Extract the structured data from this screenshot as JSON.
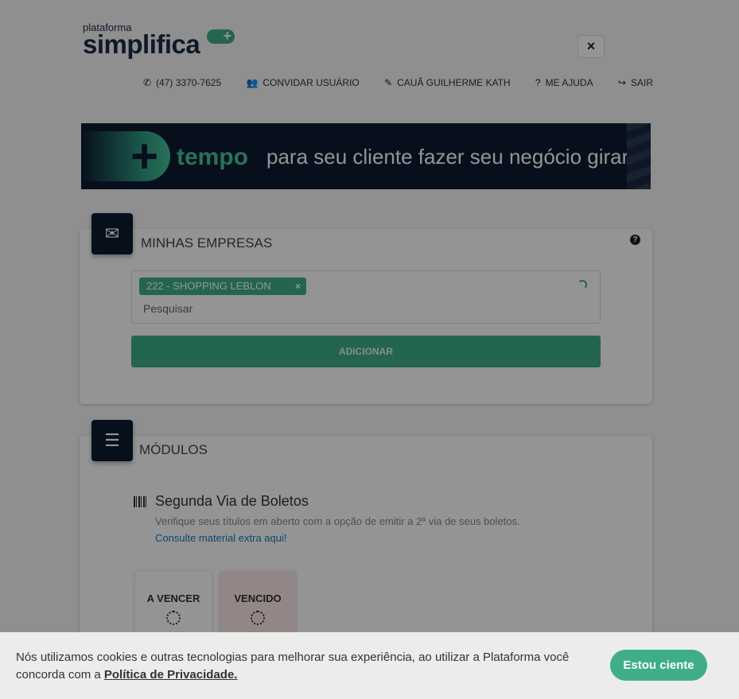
{
  "header": {
    "logo_small": "plataforma",
    "logo_big": "simplifica",
    "logo_plus": "+",
    "close_label": "×",
    "nav": [
      {
        "icon": "phone-icon",
        "glyph": "✆",
        "label": "(47) 3370-7625"
      },
      {
        "icon": "users-icon",
        "glyph": "👥",
        "label": "CONVIDAR USUÁRIO"
      },
      {
        "icon": "pencil-icon",
        "glyph": "✎",
        "label": "CAUÃ GUILHERME KATH"
      },
      {
        "icon": "question-icon",
        "glyph": "?",
        "label": "ME AJUDA"
      },
      {
        "icon": "signout-icon",
        "glyph": "↪",
        "label": "SAIR"
      }
    ]
  },
  "banner": {
    "plus": "+",
    "bold_word": "tempo",
    "rest": "para seu cliente fazer seu negócio girar"
  },
  "empresas": {
    "title": "MINHAS EMPRESAS",
    "help": "?",
    "tag": "222 - SHOPPING LEBLON",
    "tag_remove": "×",
    "search_placeholder": "Pesquisar",
    "add_button": "ADICIONAR"
  },
  "modulos": {
    "title": "MÓDULOS",
    "module_title": "Segunda Via de Boletos",
    "module_desc": "Verifique seus títulos em aberto com a opção de emitir a 2ª via de seus boletos.",
    "module_link": "Consulte material extra aqui!",
    "status_a_vencer": "A VENCER",
    "status_vencido": "VENCIDO"
  },
  "cookie": {
    "text_before": "Nós utilizamos cookies e outras tecnologias para melhorar sua experiência, ao utilizar a Plataforma você concorda com a ",
    "link": "Política de Privacidade.",
    "button": "Estou ciente"
  },
  "colors": {
    "accent": "#3fae87",
    "navy": "#0d1a33",
    "overdue_bg": "#fde7e7",
    "link": "#1f7bb5"
  }
}
